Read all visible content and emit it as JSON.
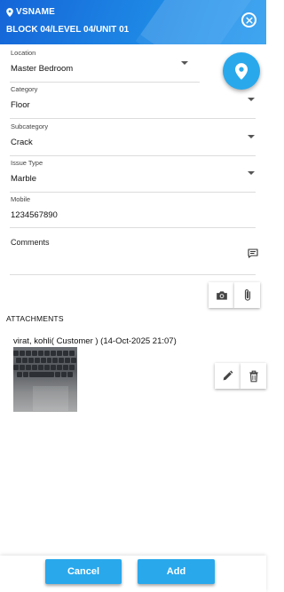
{
  "header": {
    "project": "VSNAME",
    "location_path": "BLOCK 04/LEVEL 04/UNIT 01"
  },
  "form": {
    "location": {
      "label": "Location",
      "value": "Master Bedroom"
    },
    "category": {
      "label": "Category",
      "value": "Floor"
    },
    "subcategory": {
      "label": "Subcategory",
      "value": "Crack"
    },
    "issue_type": {
      "label": "Issue Type",
      "value": "Marble"
    },
    "mobile": {
      "label": "Mobile",
      "value": "1234567890"
    },
    "comments": {
      "label": "Comments",
      "value": ""
    }
  },
  "attachments": {
    "title": "ATTACHMENTS",
    "items": [
      {
        "caption": "virat, kohli( Customer ) (14-Oct-2025 21:07)"
      }
    ]
  },
  "actions": {
    "cancel_label": "Cancel",
    "add_label": "Add"
  },
  "colors": {
    "header_blue": "#1e88e5",
    "accent": "#29a8ec"
  },
  "icons": [
    "location-pin-icon",
    "close-icon",
    "dropdown-caret-icon",
    "chat-icon",
    "camera-icon",
    "paperclip-icon",
    "edit-icon",
    "delete-icon"
  ]
}
